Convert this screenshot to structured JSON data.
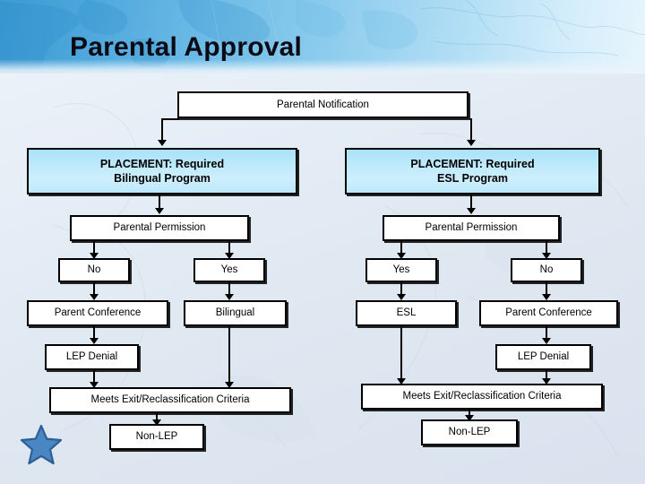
{
  "slide": {
    "title": "Parental Approval",
    "logo_icon": "star-icon",
    "accent_header_color": "#4da7dc",
    "placement_box_color": "#bfeafc",
    "box_border_color": "#000000",
    "background_color": "#e4ecf5"
  },
  "flowchart": {
    "root": {
      "label": "Parental Notification"
    },
    "branches": [
      {
        "id": "bilingual",
        "placement": {
          "line1": "PLACEMENT:  Required",
          "line2": "Bilingual Program"
        },
        "permission": {
          "label": "Parental Permission"
        },
        "options": [
          {
            "label": "No"
          },
          {
            "label": "Yes"
          }
        ],
        "outcomes": [
          {
            "label": "Parent Conference"
          },
          {
            "label": "Bilingual"
          }
        ],
        "denial": {
          "label": "LEP Denial"
        },
        "exit": {
          "label": "Meets Exit/Reclassification Criteria"
        },
        "final": {
          "label": "Non-LEP"
        }
      },
      {
        "id": "esl",
        "placement": {
          "line1": "PLACEMENT:  Required",
          "line2": "ESL Program"
        },
        "permission": {
          "label": "Parental Permission"
        },
        "options": [
          {
            "label": "Yes"
          },
          {
            "label": "No"
          }
        ],
        "outcomes": [
          {
            "label": "ESL"
          },
          {
            "label": "Parent Conference"
          }
        ],
        "denial": {
          "label": "LEP Denial"
        },
        "exit": {
          "label": "Meets Exit/Reclassification Criteria"
        },
        "final": {
          "label": "Non-LEP"
        }
      }
    ]
  }
}
